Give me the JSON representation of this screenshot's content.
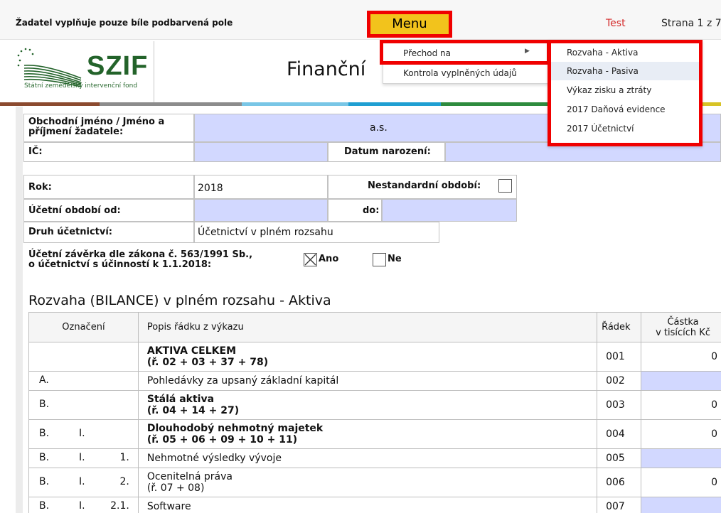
{
  "topbar": {
    "notice": "Žadatel vyplňuje pouze bíle podbarvená pole",
    "menu_label": "Menu",
    "test_label": "Test",
    "page_label": "Strana 1 z 7"
  },
  "header": {
    "logo_text": "SZIF",
    "logo_subtitle": "Státní zemědělský intervenční fond",
    "title": "Finanční"
  },
  "colors": {
    "menu_button": "#f2c31c",
    "highlight_red": "#f00000",
    "input_blue": "#d2d8ff",
    "logo_green": "#23632a",
    "stripe": [
      "#8b4a2f",
      "#8c8c8c",
      "#79c6e6",
      "#1f9fd2",
      "#2e8b3e",
      "#e39b1f",
      "#d7c326"
    ]
  },
  "menu": {
    "items": [
      {
        "label": "Přechod na",
        "has_submenu": true
      },
      {
        "label": "Kontrola vyplněných údajů",
        "has_submenu": false
      }
    ],
    "submenu": [
      {
        "label": "Rozvaha - Aktiva",
        "highlighted": false
      },
      {
        "label": "Rozvaha - Pasiva",
        "highlighted": true
      },
      {
        "label": "Výkaz zisku a ztráty",
        "highlighted": false
      },
      {
        "label": "2017 Daňová evidence",
        "highlighted": false
      },
      {
        "label": "2017 Účetnictví",
        "highlighted": false
      }
    ]
  },
  "form": {
    "obchodni_jmeno_label": "Obchodní jméno / Jméno a příjmení žadatele:",
    "obchodni_jmeno_value": "a.s.",
    "ic_label": "IČ:",
    "ic_value": "",
    "datum_narozeni_label": "Datum narození:",
    "datum_narozeni_value": "",
    "rok_label": "Rok:",
    "rok_value": "2018",
    "nestandardni_label": "Nestandardní období:",
    "nestandardni_checked": false,
    "ucetni_od_label": "Účetní období od:",
    "ucetni_od_value": "",
    "do_label": "do:",
    "do_value": "",
    "druh_label": "Druh účetnictví:",
    "druh_value": "Účetnictví v plném rozsahu",
    "zaverka_label_1": "Účetní závěrka dle zákona č. 563/1991 Sb.,",
    "zaverka_label_2": "o účetnictví s účinností k 1.1.2018:",
    "ano_label": "Ano",
    "ano_checked": true,
    "ne_label": "Ne",
    "ne_checked": false
  },
  "section_title": "Rozvaha (BILANCE) v plném rozsahu - Aktiva",
  "table": {
    "headers": {
      "oznaceni": "Označení",
      "popis": "Popis řádku z výkazu",
      "radek": "Řádek",
      "castka_1": "Částka",
      "castka_2": "v tisících Kč"
    },
    "rows": [
      {
        "m1": "",
        "m2": "",
        "m3": "",
        "desc": "AKTIVA CELKEM",
        "desc2": "(ř. 02 + 03 + 37 + 78)",
        "bold": true,
        "radek": "001",
        "amount": "0",
        "editable": false
      },
      {
        "m1": "A.",
        "m2": "",
        "m3": "",
        "desc": "Pohledávky za upsaný základní kapitál",
        "desc2": "",
        "bold": false,
        "radek": "002",
        "amount": "",
        "editable": true
      },
      {
        "m1": "B.",
        "m2": "",
        "m3": "",
        "desc": "Stálá aktiva",
        "desc2": "(ř. 04 + 14 + 27)",
        "bold": true,
        "radek": "003",
        "amount": "0",
        "editable": false
      },
      {
        "m1": "B.",
        "m2": "I.",
        "m3": "",
        "desc": "Dlouhodobý nehmotný majetek",
        "desc2": "(ř. 05 + 06 + 09 + 10 + 11)",
        "bold": true,
        "radek": "004",
        "amount": "0",
        "editable": false
      },
      {
        "m1": "B.",
        "m2": "I.",
        "m3": "1.",
        "desc": "Nehmotné výsledky vývoje",
        "desc2": "",
        "bold": false,
        "radek": "005",
        "amount": "",
        "editable": true
      },
      {
        "m1": "B.",
        "m2": "I.",
        "m3": "2.",
        "desc": "Ocenitelná práva",
        "desc2": "(ř. 07 + 08)",
        "bold": false,
        "radek": "006",
        "amount": "0",
        "editable": false
      },
      {
        "m1": "B.",
        "m2": "I.",
        "m3": "2.1.",
        "desc": "Software",
        "desc2": "",
        "bold": false,
        "radek": "007",
        "amount": "",
        "editable": true
      }
    ]
  }
}
